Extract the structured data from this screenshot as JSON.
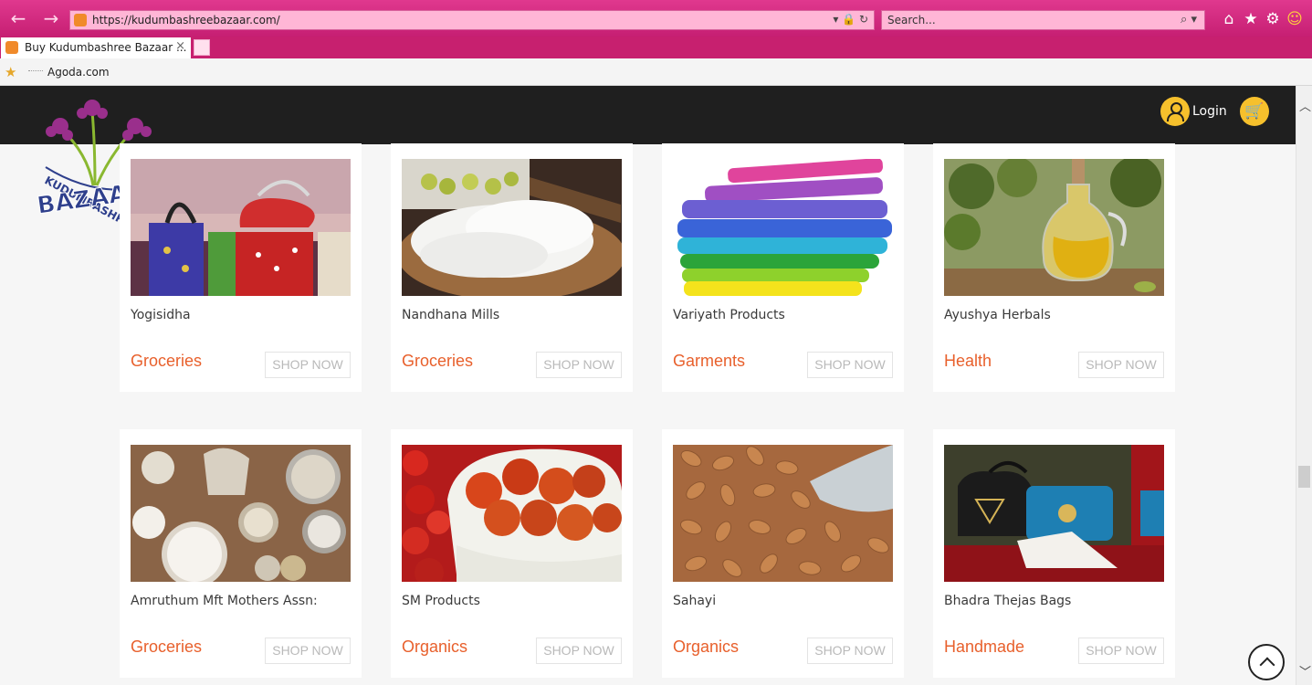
{
  "browser": {
    "url_proto": "https://",
    "url_host": "kudumbashreebazaar.com/",
    "search_placeholder": "Search...",
    "tab_title": "Buy Kudumbashree Bazaar ...",
    "favorite_label": "Agoda.com"
  },
  "header": {
    "login_label": "Login",
    "logo_text_top": "KUDUMBASHREE",
    "logo_text_bottom": "BAZAAR"
  },
  "products": [
    {
      "name": "Yogisidha",
      "category": "Groceries",
      "cta": "SHOP NOW",
      "image": "painted-kettles"
    },
    {
      "name": "Nandhana Mills",
      "category": "Groceries",
      "cta": "SHOP NOW",
      "image": "rice-flatbreads"
    },
    {
      "name": "Variyath Products",
      "category": "Garments",
      "cta": "SHOP NOW",
      "image": "folded-colored-fabric"
    },
    {
      "name": "Ayushya Herbals",
      "category": "Health",
      "cta": "SHOP NOW",
      "image": "oil-bottle"
    },
    {
      "name": "Amruthum Mft Mothers Assn:",
      "category": "Groceries",
      "cta": "SHOP NOW",
      "image": "flour-bowls"
    },
    {
      "name": "SM Products",
      "category": "Organics",
      "cta": "SHOP NOW",
      "image": "cherry-tomatoes"
    },
    {
      "name": "Sahayi",
      "category": "Organics",
      "cta": "SHOP NOW",
      "image": "almonds"
    },
    {
      "name": "Bhadra Thejas Bags",
      "category": "Handmade",
      "cta": "SHOP NOW",
      "image": "handbags"
    }
  ],
  "colors": {
    "chrome": "#c61f73",
    "header": "#1f1f1f",
    "accent_yellow": "#f6c02c",
    "category": "#e8602c"
  }
}
